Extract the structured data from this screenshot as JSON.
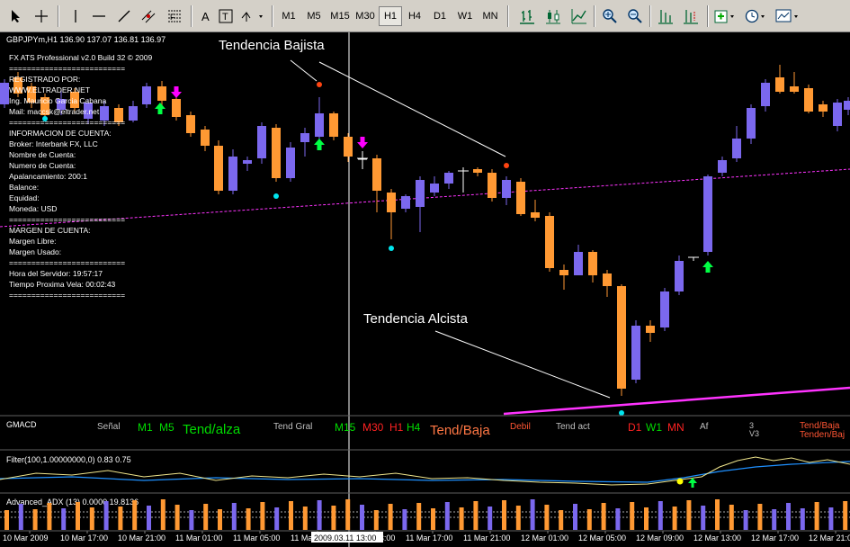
{
  "toolbar": {
    "timeframes": [
      "M1",
      "M5",
      "M15",
      "M30",
      "H1",
      "H4",
      "D1",
      "W1",
      "MN"
    ],
    "active_timeframe": "H1"
  },
  "chart_header": "GBPJPYm,H1  136.90 137.07 136.81 136.97",
  "info_panel": [
    "FX ATS Professional v2.0 Build 32 © 2009",
    "==========================",
    "REGISTRADO POR:",
    "WWW.ELTRADER.NET",
    "Ing. Mauricio Garcia Cabana",
    "Mail: maccsk@eltrader.net",
    "==========================",
    "INFORMACION DE CUENTA:",
    "Broker: Interbank FX, LLC",
    "Nombre de Cuenta:",
    "Numero de Cuenta:",
    "Apalancamiento: 200:1",
    "Balance:",
    "Equidad:",
    "Moneda: USD",
    "==========================",
    "MARGEN DE CUENTA:",
    "Margen Libre:",
    "Margen Usado:",
    "==========================",
    "Hora del Servidor: 19:57:17",
    "Tiempo Proxima Vela: 00:02:43",
    "=========================="
  ],
  "annotations": {
    "bearish": "Tendencia Bajista",
    "bullish": "Tendencia Alcista"
  },
  "gmacd": {
    "name": "GMACD",
    "senal": "Señal",
    "m1": "M1",
    "m5": "M5",
    "tend_alza": "Tend/alza",
    "tend_gral": "Tend Gral",
    "m15": "M15",
    "m30": "M30",
    "h1": "H1",
    "h4": "H4",
    "tend_baja": "Tend/Baja",
    "debil": "Debil",
    "tend_act": "Tend act",
    "d1": "D1",
    "w1": "W1",
    "mn": "MN",
    "af": "Af",
    "three": "3",
    "v3": "V3",
    "tend_baja_r": "Tend/Baja",
    "tenden_baj": "Tenden/Baj"
  },
  "filter_label": "Filter(100,1.00000000,0) 0.83 0.75",
  "adx_label": "Advanced_ADX (13) 0.0000 19.8136",
  "time_axis": [
    "10 Mar 2009",
    "10 Mar 17:00",
    "10 Mar 21:00",
    "11 Mar 01:00",
    "11 Mar 05:00",
    "11 Mar 09:00",
    "11 Mar 13:00",
    "11 Mar 17:00",
    "11 Mar 21:00",
    "12 Mar 01:00",
    "12 Mar 05:00",
    "12 Mar 09:00",
    "12 Mar 13:00",
    "12 Mar 17:00",
    "12 Mar 21:00"
  ],
  "crosshair_time": "2009.03.11 13:00",
  "colors": {
    "bull": "#7b68ee",
    "bear": "#ff9933",
    "up_arrow": "#00ff44",
    "down_arrow": "#ff00ff",
    "trendline": "#ff33ff",
    "info_text": "#ffffff"
  }
}
